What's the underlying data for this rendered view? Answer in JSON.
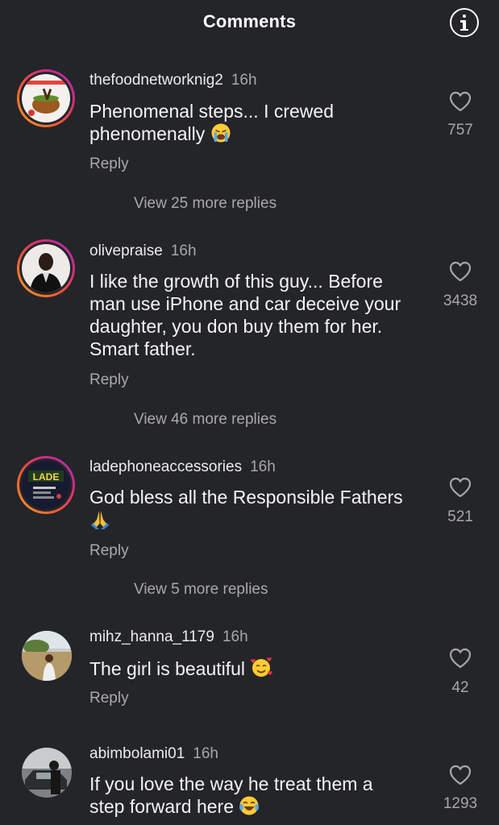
{
  "header": {
    "title": "Comments",
    "info_icon": "info-icon"
  },
  "comments": [
    {
      "username": "thefoodnetworknig2",
      "time": "16h",
      "text_line1": "Phenomenal steps... I crewed",
      "text_line2": "phenomenally",
      "emoji": "loudly-crying-face-emoji",
      "reply_label": "Reply",
      "like_count": "757",
      "view_more": "View 25 more replies",
      "avatar_ring": true
    },
    {
      "username": "olivepraise",
      "time": "16h",
      "text_line1": "I like the growth of this guy... Before",
      "text_line2": "man use iPhone and car deceive your",
      "text_line3": "daughter, you don buy them for her.",
      "text_line4": "Smart father.",
      "reply_label": "Reply",
      "like_count": "3438",
      "view_more": "View 46 more replies",
      "avatar_ring": true
    },
    {
      "username": "ladephoneaccessories",
      "time": "16h",
      "text_line1": "God bless all the Responsible Fathers",
      "emoji": "folded-hands-emoji",
      "reply_label": "Reply",
      "like_count": "521",
      "view_more": "View 5 more replies",
      "avatar_ring": true,
      "avatar_logo_text": "LADE"
    },
    {
      "username": "mihz_hanna_1179",
      "time": "16h",
      "text_line1": "The girl is beautiful",
      "emoji": "smiling-face-with-hearts-emoji",
      "reply_label": "Reply",
      "like_count": "42",
      "avatar_ring": false
    },
    {
      "username": "abimbolami01",
      "time": "16h",
      "text_line1": "If you love the way he treat them a",
      "text_line2": "step forward here",
      "emoji": "face-with-tears-of-joy-emoji",
      "like_count": "1293",
      "avatar_ring": false
    }
  ],
  "colors": {
    "background": "#242529",
    "primary_text": "#f4f4f4",
    "secondary_text": "#a9a9ab",
    "ring_gradient": [
      "#f9a12e",
      "#fb5d2f",
      "#d62a7a",
      "#a233c5"
    ]
  }
}
